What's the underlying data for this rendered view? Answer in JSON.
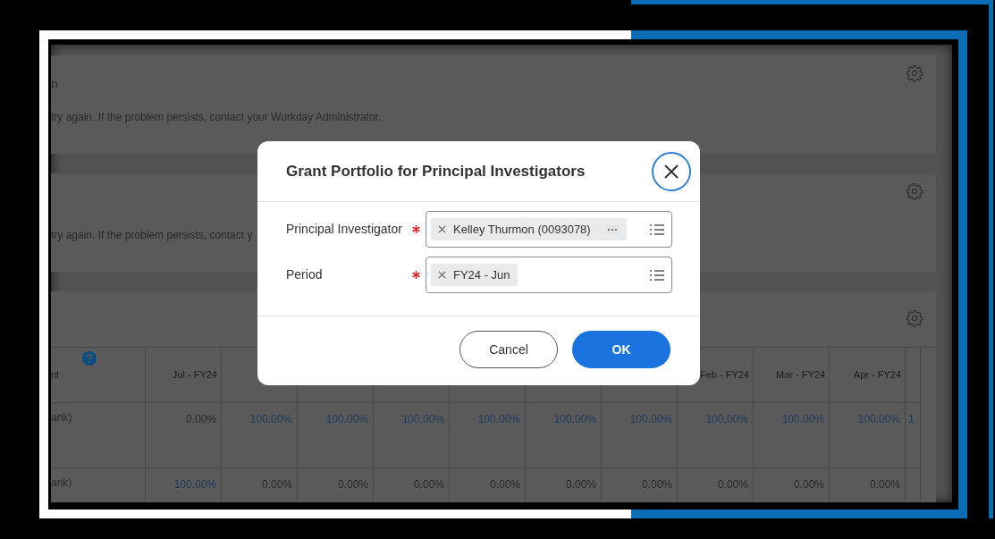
{
  "cards": [
    {
      "title": "n",
      "message": "try again. If the problem persists, contact your Workday Administrator."
    },
    {
      "message": "try again. If the problem persists, contact y"
    }
  ],
  "table": {
    "columns": [
      {
        "label": "nt",
        "help": true
      },
      {
        "label": "Jul - FY24"
      },
      {},
      {},
      {},
      {},
      {},
      {},
      {
        "label": "Feb - FY24"
      },
      {
        "label": "Mar - FY24"
      },
      {
        "label": "Apr - FY24"
      },
      {}
    ],
    "rows": [
      {
        "cells": [
          {
            "text": "ank)",
            "link": false
          },
          {
            "text": "0.00%",
            "link": false
          },
          {
            "text": "100.00%",
            "link": true
          },
          {
            "text": "100.00%",
            "link": true
          },
          {
            "text": "100.00%",
            "link": true
          },
          {
            "text": "100.00%",
            "link": true
          },
          {
            "text": "100.00%",
            "link": true
          },
          {
            "text": "100.00%",
            "link": true
          },
          {
            "text": "100.00%",
            "link": true
          },
          {
            "text": "100.00%",
            "link": true
          },
          {
            "text": "100.00%",
            "link": true
          },
          {
            "text": "1",
            "link": true
          }
        ]
      },
      {
        "cells": [
          {
            "text": "ank)",
            "link": false
          },
          {
            "text": "100.00%",
            "link": true
          },
          {
            "text": "0.00%",
            "link": false
          },
          {
            "text": "0.00%",
            "link": false
          },
          {
            "text": "0.00%",
            "link": false
          },
          {
            "text": "0.00%",
            "link": false
          },
          {
            "text": "0.00%",
            "link": false
          },
          {
            "text": "0.00%",
            "link": false
          },
          {
            "text": "0.00%",
            "link": false
          },
          {
            "text": "0.00%",
            "link": false
          },
          {
            "text": "0.00%",
            "link": false
          },
          {}
        ]
      }
    ]
  },
  "dialog": {
    "title": "Grant Portfolio for Principal Investigators",
    "fields": [
      {
        "label": "Principal Investigator",
        "required": true,
        "chips": [
          {
            "text": "Kelley Thurmon (0093078)",
            "more": true
          }
        ]
      },
      {
        "label": "Period",
        "required": true,
        "chips": [
          {
            "text": "FY24 - Jun",
            "more": false
          }
        ]
      }
    ],
    "buttons": [
      {
        "label": "Cancel",
        "kind": "secondary"
      },
      {
        "label": "OK",
        "kind": "primary"
      }
    ]
  }
}
